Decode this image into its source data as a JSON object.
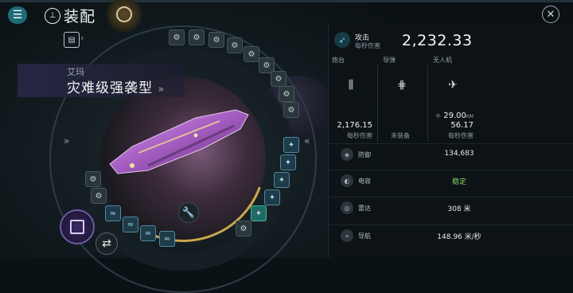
{
  "header": {
    "title": "装配",
    "menu_icon": "menu-icon",
    "title_icon": "fitting-icon",
    "target_icon": "target-icon",
    "close_icon": "close-icon"
  },
  "ship": {
    "type": "艾玛",
    "name": "灾难级强袭型",
    "name_arrow": "»"
  },
  "nav": {
    "left_chevron": "»",
    "right_chevron": "«"
  },
  "attack": {
    "label": "攻击",
    "sub": "每秒伤害",
    "value": "2,232.33"
  },
  "columns": [
    {
      "header": "炮台",
      "value": "2,176.15",
      "sub": "每秒伤害",
      "icon": "turret-icon"
    },
    {
      "header": "导弹",
      "value": "",
      "sub": "未装备",
      "icon": "missile-icon"
    },
    {
      "header": "无人机",
      "range": "29.00",
      "range_unit": "KM",
      "value": "56.17",
      "sub": "每秒伤害",
      "icon": "drone-icon"
    }
  ],
  "stats": [
    {
      "label": "防御",
      "value": "134,683",
      "icon": "shield-icon",
      "color": "#e4e9eb"
    },
    {
      "label": "电容",
      "value": "稳定",
      "icon": "capacitor-icon",
      "color": "#7fd86a"
    },
    {
      "label": "雷达",
      "value": "308 米",
      "icon": "radar-icon",
      "color": "#e4e9eb"
    },
    {
      "label": "导航",
      "value": "148.96 米/秒",
      "icon": "navigation-icon",
      "color": "#e4e9eb"
    }
  ],
  "colors": {
    "accent": "#1f6b78",
    "capacitor_stable": "#7fd86a",
    "gold": "#c9a84a"
  }
}
